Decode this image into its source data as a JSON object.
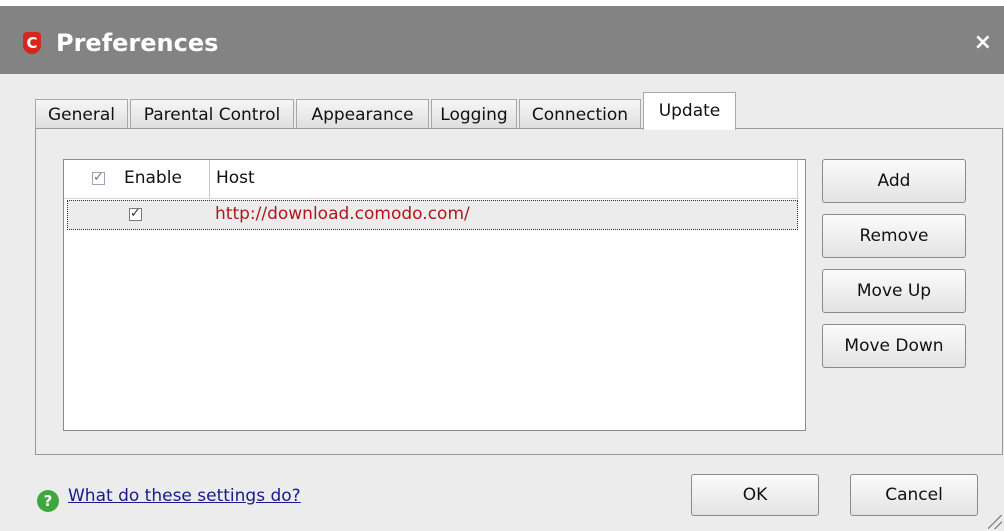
{
  "window": {
    "title": "Preferences",
    "logo_letter": "C",
    "close_glyph": "×"
  },
  "tabs": [
    {
      "label": "General"
    },
    {
      "label": "Parental Control"
    },
    {
      "label": "Appearance"
    },
    {
      "label": "Logging"
    },
    {
      "label": "Connection"
    },
    {
      "label": "Update",
      "active": true
    }
  ],
  "host_list": {
    "columns": {
      "enable": "Enable",
      "host": "Host"
    },
    "header_checked": true,
    "rows": [
      {
        "enabled": true,
        "host": "http://download.comodo.com/"
      }
    ]
  },
  "buttons": {
    "add": "Add",
    "remove": "Remove",
    "move_up": "Move Up",
    "move_down": "Move Down"
  },
  "footer": {
    "help_link": "What do these settings do?",
    "help_glyph": "?",
    "ok": "OK",
    "cancel": "Cancel"
  },
  "colors": {
    "titlebar": "#838383",
    "host_text": "#b01818",
    "help_icon": "#3ea83e"
  }
}
